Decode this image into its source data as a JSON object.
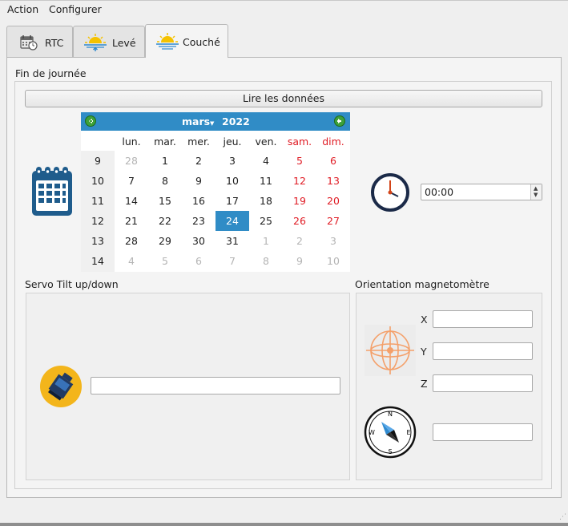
{
  "menu": {
    "action": "Action",
    "configure": "Configurer"
  },
  "tabs": [
    {
      "label": "RTC",
      "icon": "clock-calendar-icon"
    },
    {
      "label": "Levé",
      "icon": "sunrise-icon"
    },
    {
      "label": "Couché",
      "icon": "sunset-icon",
      "active": true
    }
  ],
  "section_end_day": "Fin de journée",
  "read_button": "Lire les données",
  "calendar": {
    "month": "mars",
    "year": "2022",
    "day_headers": [
      "lun.",
      "mar.",
      "mer.",
      "jeu.",
      "ven.",
      "sam.",
      "dim."
    ],
    "week_numbers": [
      "9",
      "10",
      "11",
      "12",
      "13",
      "14"
    ],
    "weeks": [
      [
        "28",
        "1",
        "2",
        "3",
        "4",
        "5",
        "6"
      ],
      [
        "7",
        "8",
        "9",
        "10",
        "11",
        "12",
        "13"
      ],
      [
        "14",
        "15",
        "16",
        "17",
        "18",
        "19",
        "20"
      ],
      [
        "21",
        "22",
        "23",
        "24",
        "25",
        "26",
        "27"
      ],
      [
        "28",
        "29",
        "30",
        "31",
        "1",
        "2",
        "3"
      ],
      [
        "4",
        "5",
        "6",
        "7",
        "8",
        "9",
        "10"
      ]
    ],
    "selected": "24"
  },
  "time_value": "00:00",
  "servo_label": "Servo Tilt up/down",
  "servo_value": "",
  "orientation_label": "Orientation magnetomètre",
  "axes": {
    "x": "X",
    "y": "Y",
    "z": "Z"
  },
  "magneto": {
    "x": "",
    "y": "",
    "z": "",
    "heading": ""
  },
  "compass": {
    "n": "N",
    "s": "S",
    "e": "E",
    "w": "W"
  },
  "colors": {
    "accent": "#308cc6",
    "weekend": "#e01b24",
    "calendar_icon": "#1f5c8c"
  }
}
